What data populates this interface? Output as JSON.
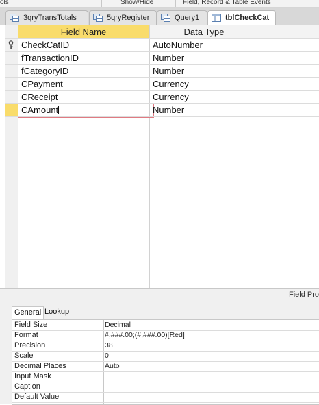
{
  "ribbon": {
    "groups": [
      "ols",
      "Show/Hide",
      "Field, Record & Table Events"
    ]
  },
  "tabs": [
    {
      "label": "3qryTransTotals",
      "icon": "query-icon",
      "active": false
    },
    {
      "label": "5qryRegister",
      "icon": "query-icon",
      "active": false
    },
    {
      "label": "Query1",
      "icon": "query-icon",
      "active": false
    },
    {
      "label": "tblCheckCat",
      "icon": "table-icon",
      "active": true
    }
  ],
  "grid": {
    "headers": {
      "field_name": "Field Name",
      "data_type": "Data Type"
    },
    "rows": [
      {
        "field_name": "CheckCatID",
        "data_type": "AutoNumber",
        "primary_key": true
      },
      {
        "field_name": "fTransactionID",
        "data_type": "Number"
      },
      {
        "field_name": "fCategoryID",
        "data_type": "Number"
      },
      {
        "field_name": "CPayment",
        "data_type": "Currency"
      },
      {
        "field_name": "CReceipt",
        "data_type": "Currency"
      },
      {
        "field_name": "CAmount",
        "data_type": "Number",
        "selected": true
      }
    ]
  },
  "field_properties_label": "Field Pro",
  "property_tabs": {
    "general": "General",
    "lookup": "Lookup"
  },
  "properties": [
    {
      "label": "Field Size",
      "value": "Decimal"
    },
    {
      "label": "Format",
      "value": "#,###.00;(#,###.00)[Red]"
    },
    {
      "label": "Precision",
      "value": "38"
    },
    {
      "label": "Scale",
      "value": "0"
    },
    {
      "label": "Decimal Places",
      "value": "Auto"
    },
    {
      "label": "Input Mask",
      "value": ""
    },
    {
      "label": "Caption",
      "value": ""
    },
    {
      "label": "Default Value",
      "value": ""
    }
  ],
  "colors": {
    "header_highlight": "#f9dc6b",
    "row_selector_selected": "#f9dc6b",
    "active_cell_border": "#e07a82",
    "key_icon": "#444444"
  }
}
